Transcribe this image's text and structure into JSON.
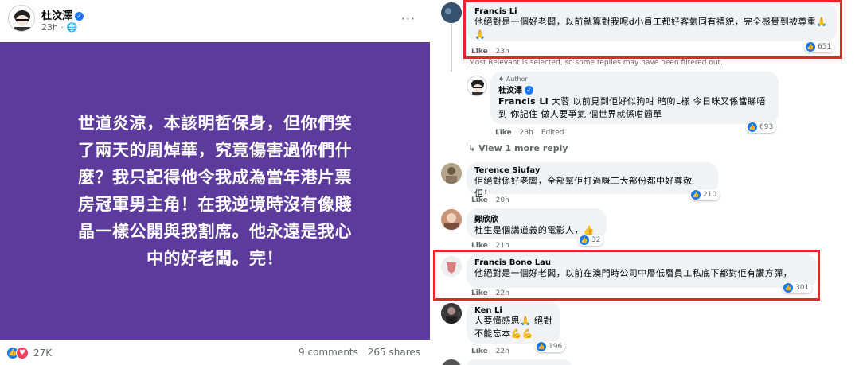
{
  "post": {
    "author": "杜汶澤",
    "time": "23h",
    "privacy_icon": "globe-icon",
    "more": "···",
    "text": "世道炎涼，本該明哲保身，但你們笑了兩天的周焯華，究竟傷害過你們什麼？我只記得他令我成為當年港片票房冠軍男主角！在我逆境時沒有像賤晶一樣公開與我割席。他永遠是我心中的好老闆。完！",
    "background_color": "#5c3b9c",
    "reaction_count": "27K",
    "comments_count": "9 comments",
    "shares_count": "265 shares"
  },
  "comments": {
    "c1": {
      "name": "Francis Li",
      "text": "他絕對是一個好老闆，以前就算對我呢d小員工都好客氣同有禮貌，完全感覺到被尊重🙏🙏",
      "like": "Like",
      "time": "23h",
      "likes": "651"
    },
    "filter_note": "Most Relevant is selected, so some replies may have been filtered out.",
    "reply": {
      "tag": "Author",
      "name": "杜汶澤",
      "mention": "Francis Li",
      "text": " 大蓉 以前見到佢好似狗咁 暗啲L樣 今日咪又係當睇唔到 你記住 做人要爭氣 個世界就係咁簡單",
      "like": "Like",
      "time": "23h",
      "edited": "Edited",
      "likes": "693"
    },
    "view_more": "View 1 more reply",
    "c2": {
      "name": "Terence Siufay",
      "text": "佢絕對係好老闆，全部幫佢打過嘅工大部份都中好尊敬佢！",
      "like": "Like",
      "time": "20h",
      "likes": "210"
    },
    "c3": {
      "name": "鄭欣欣",
      "text": "杜生是個講道義的電影人，👍",
      "like": "Like",
      "time": "21h",
      "likes": "32"
    },
    "c4": {
      "name": "Francis Bono Lau",
      "text": "他絕對是一個好老闆，以前在澳門時公司中層低層員工私底下都對佢有讚方彈，",
      "like": "Like",
      "time": "22h",
      "likes": "301"
    },
    "c5": {
      "name": "Ken Li",
      "text": "人要懂感恩🙏 絕對不能忘本💪💪",
      "like": "Like",
      "time": "22h",
      "likes": "196"
    }
  },
  "colors": {
    "highlight": "#e8262a",
    "like_blue": "#1877f2"
  }
}
